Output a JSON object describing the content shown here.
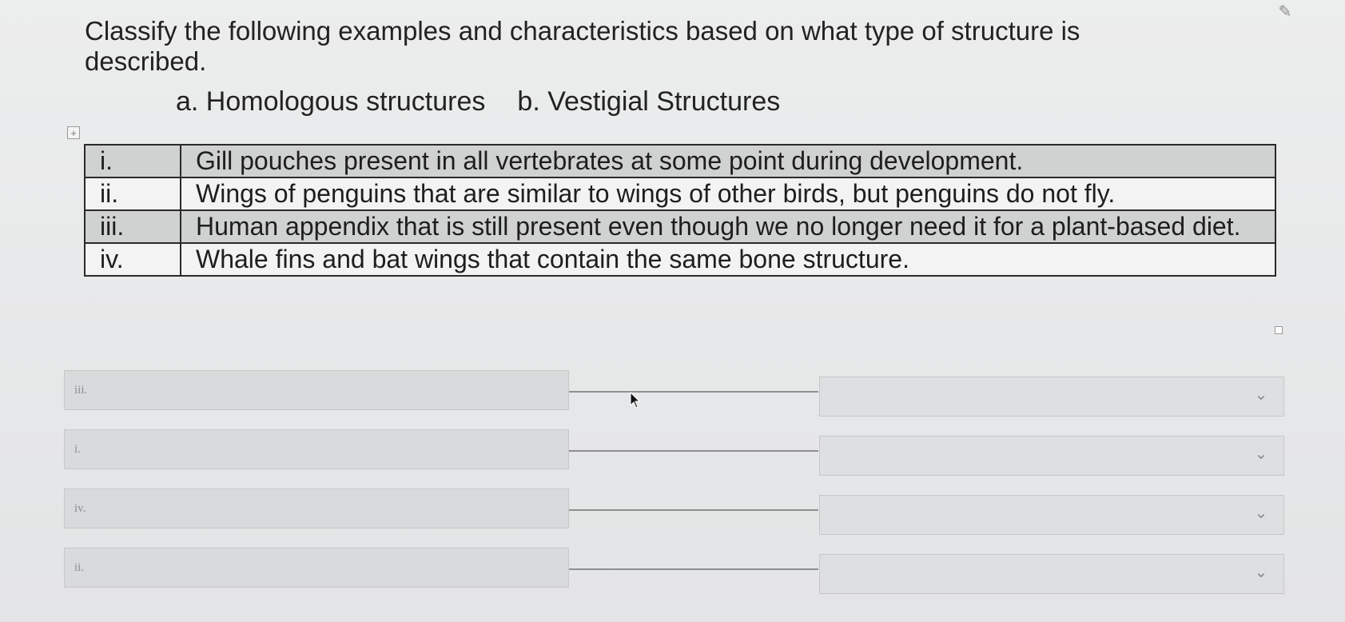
{
  "question": {
    "prompt": "Classify the following examples and characteristics based on what type of structure is described.",
    "options": [
      {
        "label": "a. Homologous structures"
      },
      {
        "label": "b. Vestigial Structures"
      }
    ]
  },
  "examples_table": {
    "rows": [
      {
        "num": "i.",
        "text": "Gill pouches present in all vertebrates at some point during development."
      },
      {
        "num": "ii.",
        "text": "Wings of penguins that are similar to wings of other birds, but penguins do not fly."
      },
      {
        "num": "iii.",
        "text": "Human appendix that is still present even though we no longer need it for a plant-based diet."
      },
      {
        "num": "iv.",
        "text": "Whale fins and bat wings that contain the same bone structure."
      }
    ]
  },
  "matching": {
    "items": [
      {
        "label": "iii.",
        "selected": ""
      },
      {
        "label": "i.",
        "selected": ""
      },
      {
        "label": "iv.",
        "selected": ""
      },
      {
        "label": "ii.",
        "selected": ""
      }
    ]
  },
  "icons": {
    "pin": "pin-icon",
    "move": "move-handle-icon",
    "chevron": "chevron-down-icon",
    "cursor": "mouse-cursor-icon"
  }
}
